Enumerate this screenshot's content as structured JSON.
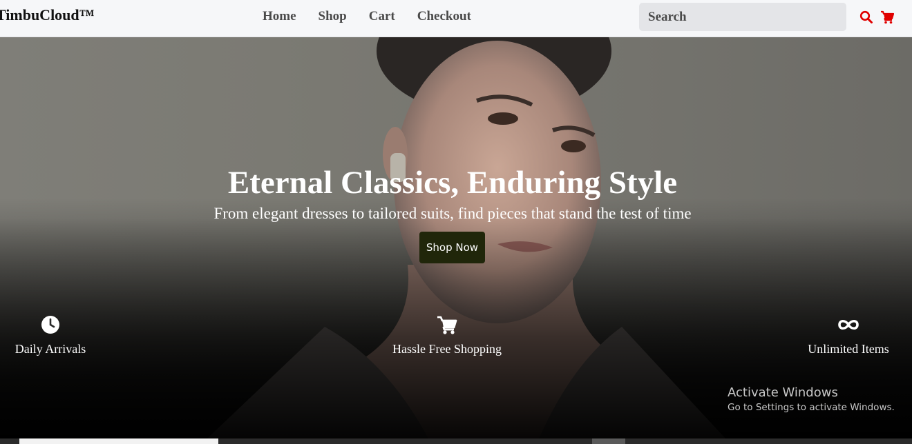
{
  "header": {
    "brand": "TimbuCloud™",
    "nav": [
      "Home",
      "Shop",
      "Cart",
      "Checkout"
    ],
    "search_placeholder": "Search",
    "icons": [
      "search-icon",
      "cart-icon"
    ],
    "accent_color": "#e00000"
  },
  "hero": {
    "title": "Eternal Classics, Enduring Style",
    "subtitle": "From elegant dresses to tailored suits, find pieces that stand the test of time",
    "cta": "Shop Now"
  },
  "features": [
    {
      "icon": "clock-icon",
      "label": "Daily Arrivals"
    },
    {
      "icon": "cart-icon",
      "label": "Hassle Free Shopping"
    },
    {
      "icon": "infinity-icon",
      "label": "Unlimited Items"
    }
  ],
  "watermark": {
    "line1": "Activate Windows",
    "line2": "Go to Settings to activate Windows."
  }
}
